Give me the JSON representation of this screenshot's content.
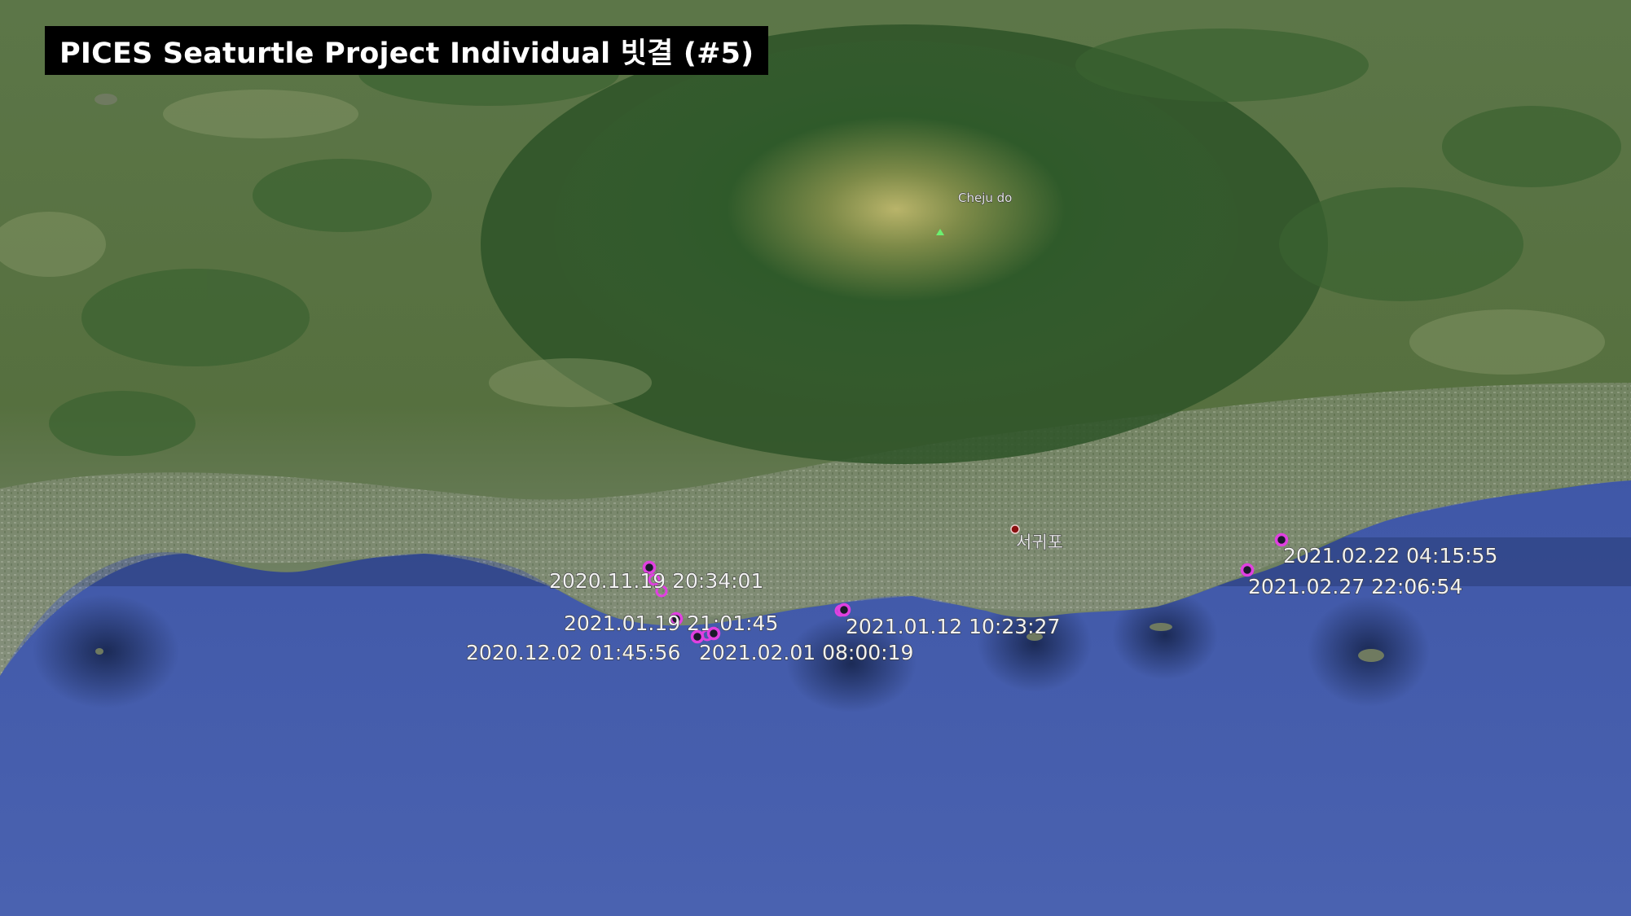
{
  "title": "PICES Seaturtle Project Individual 빗결 (#5)",
  "places": {
    "island_name": "Cheju do",
    "city_name": "서귀포"
  },
  "track": [
    {
      "label": "2020.11.19 20:34:01"
    },
    {
      "label": "2021.01.19 21:01:45"
    },
    {
      "label": "2020.12.02 01:45:56"
    },
    {
      "label": "2021.02.01 08:00:19"
    },
    {
      "label": "2021.01.12 10:23:27"
    },
    {
      "label": "2021.02.22 04:15:55"
    },
    {
      "label": "2021.02.27 22:06:54"
    }
  ],
  "colors": {
    "sea": "#3f5aa8",
    "land": "#4e6b3c",
    "forest": "#2f5a2a",
    "marker": "#e040e0",
    "city_marker": "#8a1010"
  },
  "icons": {
    "marker": "circle-marker-icon",
    "peak": "mountain-peak-icon",
    "city": "city-dot-icon"
  }
}
